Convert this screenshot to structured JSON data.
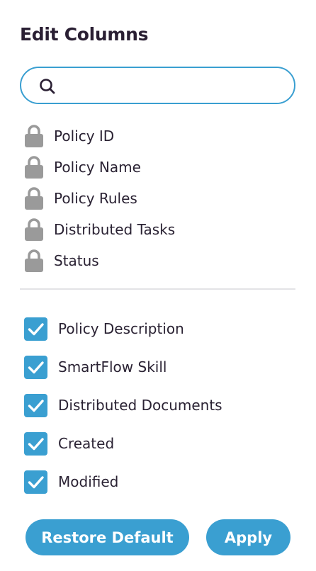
{
  "panel": {
    "title": "Edit Columns"
  },
  "search": {
    "value": "",
    "placeholder": "",
    "icon": "search-icon"
  },
  "locked_columns": [
    {
      "label": "Policy ID",
      "icon": "lock-icon"
    },
    {
      "label": "Policy Name",
      "icon": "lock-icon"
    },
    {
      "label": "Policy Rules",
      "icon": "lock-icon"
    },
    {
      "label": "Distributed Tasks",
      "icon": "lock-icon"
    },
    {
      "label": "Status",
      "icon": "lock-icon"
    }
  ],
  "optional_columns": [
    {
      "label": "Policy Description",
      "checked": true
    },
    {
      "label": "SmartFlow Skill",
      "checked": true
    },
    {
      "label": "Distributed Documents",
      "checked": true
    },
    {
      "label": "Created",
      "checked": true
    },
    {
      "label": "Modified",
      "checked": true
    }
  ],
  "buttons": {
    "restore_label": "Restore Default",
    "apply_label": "Apply"
  },
  "colors": {
    "accent": "#3a9fd1",
    "lock": "#9a9a9a",
    "text": "#2a2233",
    "divider": "#e3e3e6"
  }
}
